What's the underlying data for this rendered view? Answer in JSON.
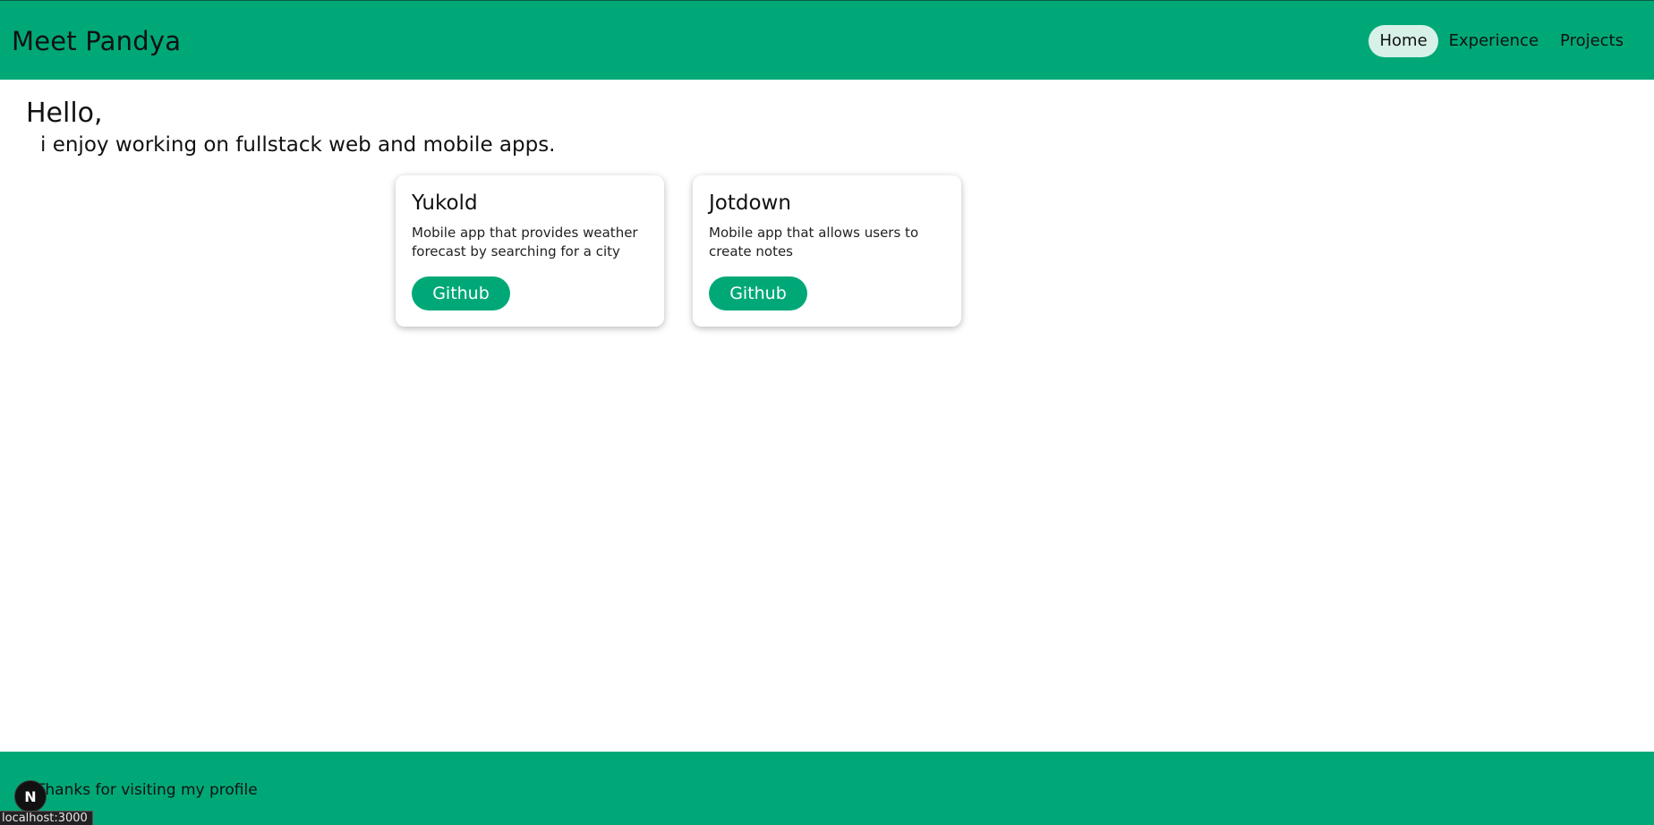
{
  "header": {
    "brand": "Meet Pandya",
    "nav": [
      {
        "label": "Home",
        "active": true
      },
      {
        "label": "Experience",
        "active": false
      },
      {
        "label": "Projects",
        "active": false
      }
    ]
  },
  "main": {
    "greeting": "Hello,",
    "tagline": "i enjoy working on fullstack web and mobile apps.",
    "projects": [
      {
        "title": "Yukold",
        "description": "Mobile app that provides weather forecast by searching for a city",
        "button_label": "Github"
      },
      {
        "title": "Jotdown",
        "description": "Mobile app that allows users to create notes",
        "button_label": "Github"
      }
    ]
  },
  "footer": {
    "text": "Thanks for visiting my profile"
  },
  "overlay": {
    "badge_letter": "N",
    "status_url": "localhost:3000"
  },
  "colors": {
    "brand_green": "#00a878",
    "active_nav_bg": "#d7f1e8"
  }
}
